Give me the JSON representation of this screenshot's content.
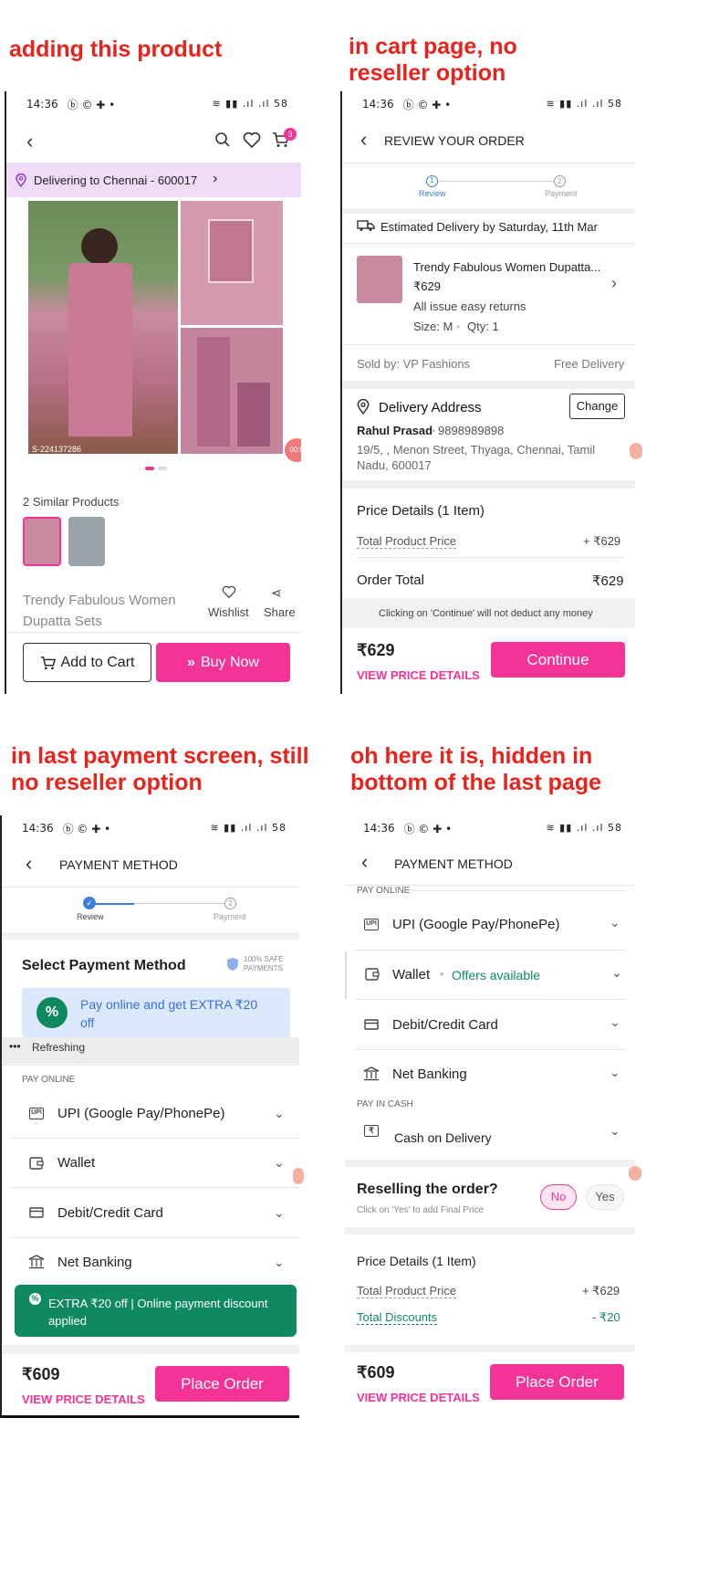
{
  "captions": {
    "c1": "adding this product",
    "c2a": "in cart page, no",
    "c2b": "reseller option",
    "c3a": "in last payment screen, still",
    "c3b": "no reseller option",
    "c4a": "oh here it is, hidden in",
    "c4b": "bottom of the last page"
  },
  "status": {
    "time": "14:36",
    "icons": "ⓑ © ✚ •",
    "right": "≋ ▮▮ .ıl .ıl 58"
  },
  "p1": {
    "cart_count": "3",
    "delivering": "Delivering to Chennai - 600017",
    "watermark": "S-224137286",
    "similar": "2 Similar Products",
    "title1": "Trendy Fabulous Women",
    "title2": "Dupatta Sets",
    "wishlist": "Wishlist",
    "share": "Share",
    "add_to_cart": "Add to Cart",
    "buy_now": "Buy Now",
    "timer": "00:0"
  },
  "p2": {
    "header": "REVIEW YOUR ORDER",
    "step1": "Review",
    "step2": "Payment",
    "step1_num": "1",
    "step2_num": "2",
    "est": "Estimated Delivery by Saturday, 11th Mar",
    "product": "Trendy Fabulous Women Dupatta...",
    "price": "₹629",
    "returns": "All issue easy returns",
    "size": "Size: M",
    "qty": "Qty: 1",
    "sold_by": "Sold by: VP Fashions",
    "free_delivery": "Free Delivery",
    "addr_title": "Delivery Address",
    "change": "Change",
    "name": "Rahul Prasad",
    "phone": "9898989898",
    "addr1": "19/5, , Menon Street, Thyaga, Chennai, Tamil",
    "addr2": "Nadu, 600017",
    "pd_title": "Price Details (1 Item)",
    "tpp": "Total Product Price",
    "tpp_val": "+ ₹629",
    "order_total": "Order Total",
    "order_total_val": "₹629",
    "notice": "Clicking on 'Continue' will not deduct any money",
    "bottom_price": "₹629",
    "view_price": "VIEW PRICE DETAILS",
    "continue": "Continue"
  },
  "p3": {
    "header": "PAYMENT METHOD",
    "step1": "Review",
    "step2": "Payment",
    "step2_num": "2",
    "select": "Select Payment Method",
    "safe1": "100% SAFE",
    "safe2": "PAYMENTS",
    "promo1": "Pay online and get EXTRA ₹20",
    "promo2": "off",
    "refreshing": "Refreshing",
    "pay_online": "PAY ONLINE",
    "upi": "UPI (Google Pay/PhonePe)",
    "upi_ico": "UPI",
    "wallet": "Wallet",
    "card": "Debit/Credit Card",
    "netbank": "Net Banking",
    "toast1": "EXTRA ₹20 off | Online payment discount",
    "toast2": "applied",
    "bottom_price": "₹609",
    "view_price": "VIEW PRICE DETAILS",
    "place": "Place Order"
  },
  "p4": {
    "header": "PAYMENT METHOD",
    "pay_online": "PAY ONLINE",
    "upi": "UPI (Google Pay/PhonePe)",
    "upi_ico": "UPI",
    "wallet": "Wallet",
    "offers": "Offers available",
    "card": "Debit/Credit Card",
    "netbank": "Net Banking",
    "pay_cash": "PAY IN CASH",
    "cod": "Cash on Delivery",
    "resell": "Reselling the order?",
    "resell_sub": "Click on 'Yes' to add Final Price",
    "no": "No",
    "yes": "Yes",
    "pd_title": "Price Details (1 Item)",
    "tpp": "Total Product Price",
    "tpp_val": "+ ₹629",
    "disc": "Total Discounts",
    "disc_val": "- ₹20",
    "bottom_price": "₹609",
    "view_price": "VIEW PRICE DETAILS",
    "place": "Place Order"
  },
  "colors": {
    "accent": "#f43397",
    "caption": "#e8231c",
    "green": "#0f8a5f",
    "blue": "#3b7de0"
  }
}
